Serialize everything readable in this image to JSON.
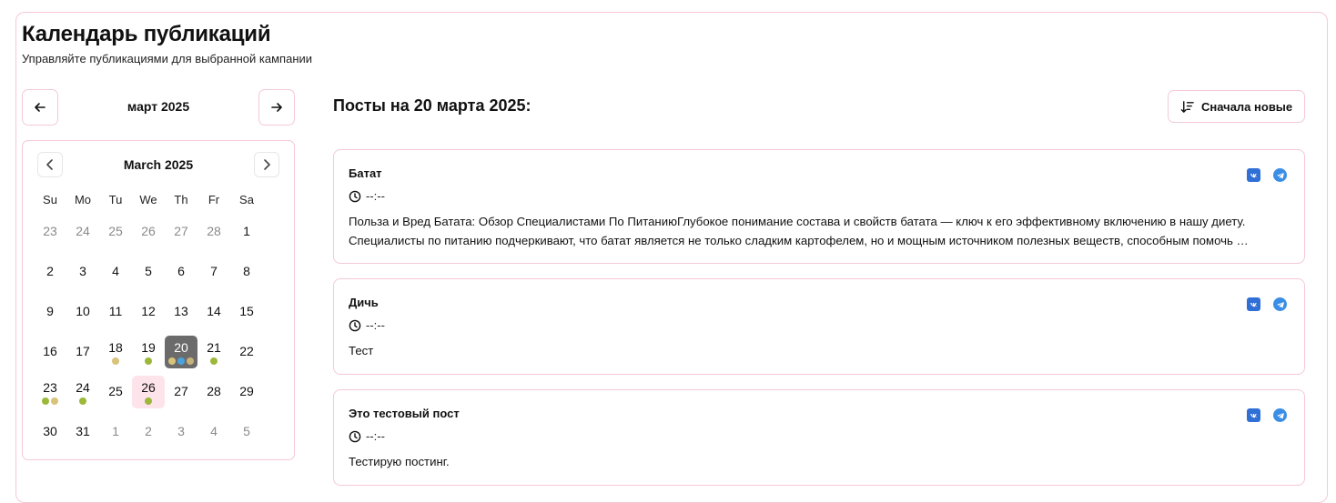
{
  "header": {
    "title": "Календарь публикаций",
    "subtitle": "Управляйте публикациями для выбранной кампании"
  },
  "month_nav": {
    "label": "март 2025",
    "prev_icon": "arrow-left-icon",
    "next_icon": "arrow-right-icon"
  },
  "calendar": {
    "title": "March 2025",
    "weekdays": [
      "Su",
      "Mo",
      "Tu",
      "We",
      "Th",
      "Fr",
      "Sa"
    ],
    "weeks": [
      [
        {
          "d": "23",
          "out": true
        },
        {
          "d": "24",
          "out": true
        },
        {
          "d": "25",
          "out": true
        },
        {
          "d": "26",
          "out": true
        },
        {
          "d": "27",
          "out": true
        },
        {
          "d": "28",
          "out": true
        },
        {
          "d": "1"
        }
      ],
      [
        {
          "d": "2"
        },
        {
          "d": "3"
        },
        {
          "d": "4"
        },
        {
          "d": "5"
        },
        {
          "d": "6"
        },
        {
          "d": "7"
        },
        {
          "d": "8"
        }
      ],
      [
        {
          "d": "9"
        },
        {
          "d": "10"
        },
        {
          "d": "11"
        },
        {
          "d": "12"
        },
        {
          "d": "13"
        },
        {
          "d": "14"
        },
        {
          "d": "15"
        }
      ],
      [
        {
          "d": "16"
        },
        {
          "d": "17"
        },
        {
          "d": "18",
          "dots": [
            "#d9c27a"
          ]
        },
        {
          "d": "19",
          "dots": [
            "#9cb83a"
          ]
        },
        {
          "d": "20",
          "selected": true,
          "dots": [
            "#d9c27a",
            "#4aa3df",
            "#c9b27a"
          ]
        },
        {
          "d": "21",
          "dots": [
            "#9cb83a"
          ]
        },
        {
          "d": "22"
        }
      ],
      [
        {
          "d": "23",
          "dots": [
            "#9cb83a",
            "#d9c27a"
          ]
        },
        {
          "d": "24",
          "dots": [
            "#9cb83a"
          ]
        },
        {
          "d": "25"
        },
        {
          "d": "26",
          "today": true,
          "dots": [
            "#9cb83a"
          ]
        },
        {
          "d": "27"
        },
        {
          "d": "28"
        },
        {
          "d": "29"
        }
      ],
      [
        {
          "d": "30"
        },
        {
          "d": "31"
        },
        {
          "d": "1",
          "out": true
        },
        {
          "d": "2",
          "out": true
        },
        {
          "d": "3",
          "out": true
        },
        {
          "d": "4",
          "out": true
        },
        {
          "d": "5",
          "out": true
        }
      ]
    ]
  },
  "posts_title": "Посты на 20 марта 2025:",
  "sort_button": {
    "label": "Сначала новые",
    "icon": "sort-descending-icon"
  },
  "colors": {
    "border": "#f5c9d6",
    "vk": "#2f6fd6",
    "telegram": "#3b8ee6",
    "selected_day": "#6b6b6b",
    "today_day": "#fde3ea"
  },
  "posts": [
    {
      "title": "Батат",
      "time": "--:--",
      "body": "Польза и Вред Батата: Обзор Специалистами По ПитаниюГлубокое понимание состава и свойств батата — ключ к его эффективному включению в нашу диету. Специалисты по питанию подчеркивают, что батат является не только сладким картофелем, но и мощным источником полезных веществ, способным помочь в профилактике многих заболеваний."
    },
    {
      "title": "Дичь",
      "time": "--:--",
      "body": "Тест"
    },
    {
      "title": "Это тестовый пост",
      "time": "--:--",
      "body": "Тестирую постинг."
    }
  ]
}
